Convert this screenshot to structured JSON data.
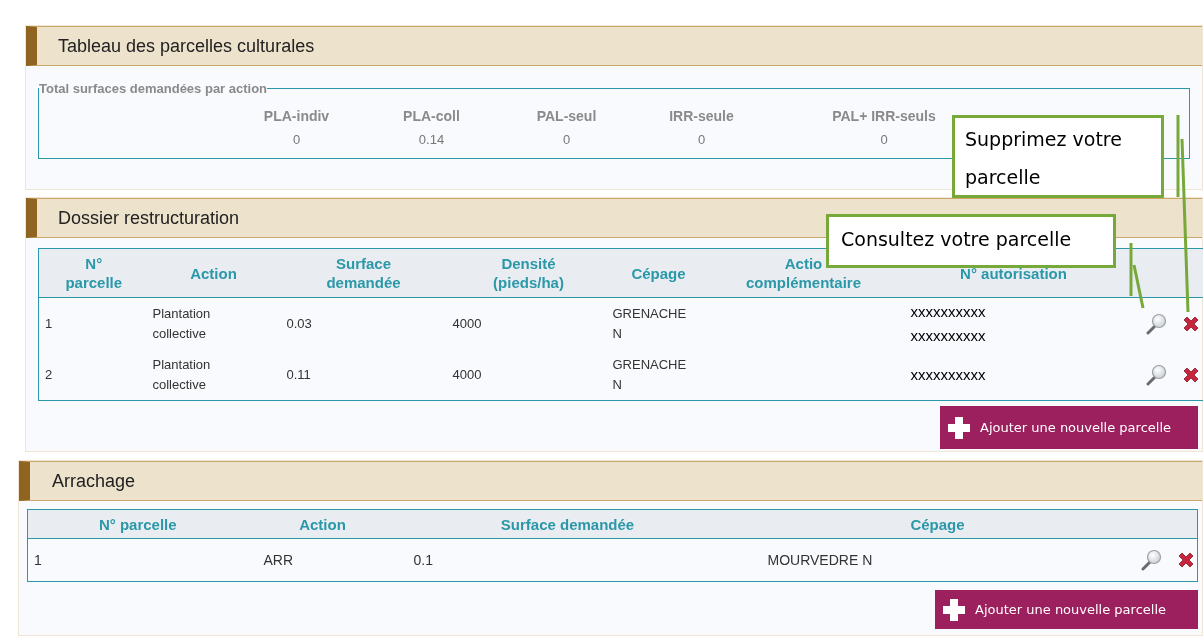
{
  "panels": [
    {
      "title": "Tableau des parcelles culturales",
      "summary": {
        "legend": "Total surfaces demandées par action",
        "items": [
          {
            "label": "PLA-indiv",
            "value": "0"
          },
          {
            "label": "PLA-coll",
            "value": "0.14"
          },
          {
            "label": "PAL-seul",
            "value": "0"
          },
          {
            "label": "IRR-seule",
            "value": "0"
          },
          {
            "label": "PAL+ IRR-seuls",
            "value": "0"
          }
        ]
      }
    },
    {
      "title": "Dossier restructuration",
      "table": {
        "kind": "restructuration",
        "columns": [
          "N°\nparcelle",
          "Action",
          "Surface\ndemandée",
          "Densité\n(pieds/ha)",
          "Cépage",
          "Actio\ncomplémentaire",
          "N° autorisation"
        ],
        "rows": [
          {
            "cells": [
              "1",
              "Plantation\ncollective",
              "0.03",
              "4000",
              "GRENACHE\nN",
              "",
              [
                "xxxxxxxxxx",
                "xxxxxxxxxx"
              ]
            ]
          },
          {
            "cells": [
              "2",
              "Plantation\ncollective",
              "0.11",
              "4000",
              "GRENACHE\nN",
              "",
              [
                "xxxxxxxxxx"
              ]
            ]
          }
        ]
      },
      "add_button": "Ajouter une nouvelle parcelle"
    },
    {
      "title": "Arrachage",
      "table": {
        "kind": "arrachage",
        "columns": [
          "N° parcelle",
          "Action",
          "Surface demandée",
          "Cépage"
        ],
        "rows": [
          {
            "cells": [
              "1",
              "ARR",
              "0.1",
              "MOURVEDRE N"
            ]
          }
        ]
      },
      "add_button": "Ajouter une nouvelle parcelle"
    }
  ],
  "callouts": [
    {
      "text": "Supprimez votre parcelle"
    },
    {
      "text": "Consultez votre parcelle"
    }
  ]
}
